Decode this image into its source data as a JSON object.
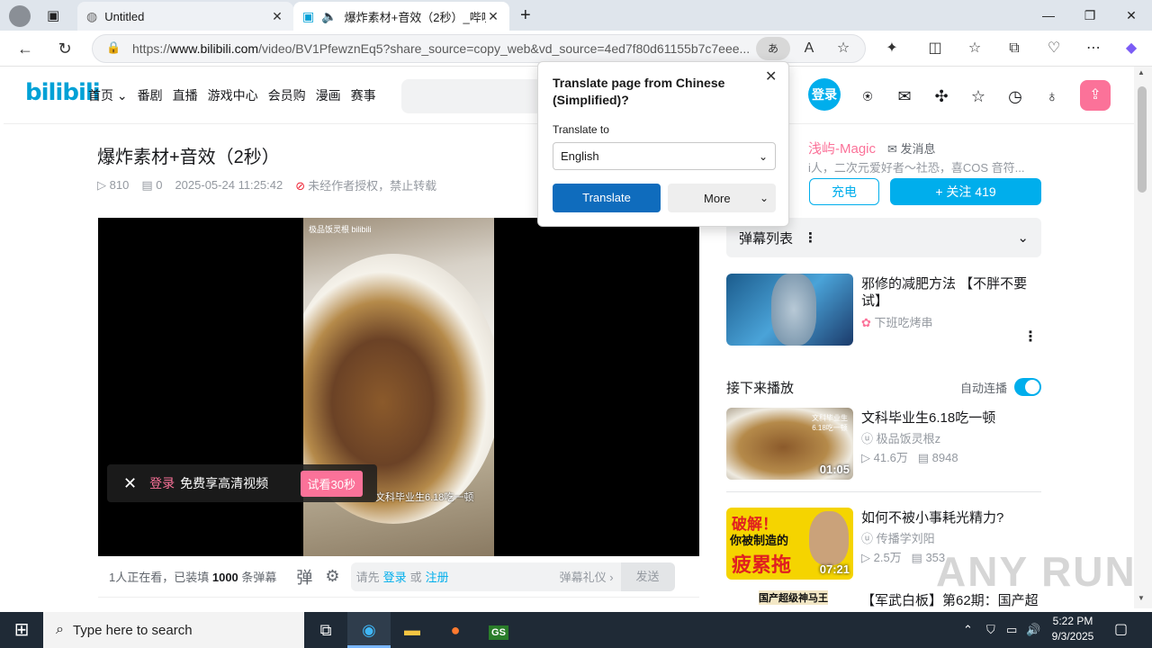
{
  "browser": {
    "tabs": [
      {
        "title": "Untitled",
        "active": false
      },
      {
        "title": "爆炸素材+音效（2秒）_哔哩",
        "active": true
      }
    ],
    "url_prefix": "https://",
    "url_domain": "www.bilibili.com",
    "url_rest": "/video/BV1PfewznEq5?share_source=copy_web&vd_source=4ed7f80d61155b7c7eee..."
  },
  "header": {
    "logo": "bilibili",
    "nav": [
      "首页 ⌄",
      "番剧",
      "直播",
      "游戏中心",
      "会员购",
      "漫画",
      "赛事"
    ],
    "login": "登录"
  },
  "video": {
    "title": "爆炸素材+音效（2秒）",
    "views": "810",
    "danmaku": "0",
    "date": "2025-05-24 11:25:42",
    "notice": "未经作者授权，禁止转载",
    "watermark": "极品饭灵根",
    "watermark_logo": "bilibili",
    "subtitle": "文科毕业生6.18吃一顿",
    "promo_login": "登录",
    "promo_text": "免费享高清视频",
    "promo_button": "试看30秒"
  },
  "danmubar": {
    "viewers_prefix": "1人正在看，已装填",
    "viewers_count": "1000",
    "viewers_suffix": "条弹幕",
    "please": "请先",
    "login": "登录",
    "or": "或",
    "register": "注册",
    "etiquette": "弹幕礼仪 ›",
    "send": "发送"
  },
  "uploader": {
    "name": "浅屿-Magic",
    "message": "发消息",
    "desc": "i人，二次元爱好者～社恐，喜COS 音符...",
    "charge": "充电",
    "follow": "+ 关注 419"
  },
  "danmu_list": {
    "label": "弹幕列表"
  },
  "ad_card": {
    "title": "邪修的减肥方法 【不胖不要试】",
    "author": "下班吃烤串"
  },
  "up_next": {
    "header": "接下来播放",
    "autoplay": "自动连播"
  },
  "recommendations": [
    {
      "title": "文科毕业生6.18吃一顿",
      "author": "极品饭灵根z",
      "views": "41.6万",
      "danmaku": "8948",
      "duration": "01:05",
      "thumb_text": "文科毕业生 6.18吃一顿"
    },
    {
      "title": "如何不被小事耗光精力?",
      "author": "传播学刘阳",
      "views": "2.5万",
      "danmaku": "353",
      "duration": "07:21",
      "thumb_text1": "破解！",
      "thumb_text2": "你被制造的",
      "thumb_text3": "疲累拖"
    },
    {
      "title": "【军武白板】第62期：国产超",
      "thumb_text": "国产超级神马王"
    }
  ],
  "translate_popup": {
    "title": "Translate page from Chinese (Simplified)?",
    "to_label": "Translate to",
    "language": "English",
    "translate_button": "Translate",
    "more_button": "More"
  },
  "taskbar": {
    "search_placeholder": "Type here to search",
    "time": "5:22 PM",
    "date": "9/3/2025"
  },
  "overlay_watermark": "ANY RUN"
}
